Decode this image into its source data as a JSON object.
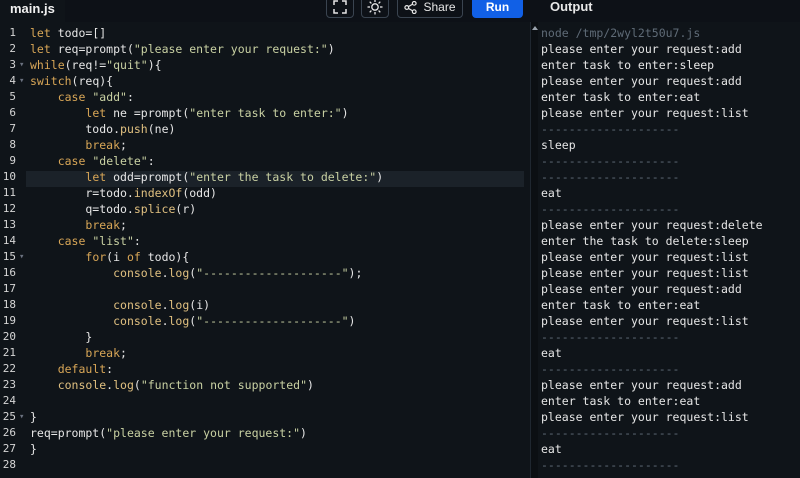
{
  "topbar": {
    "file_tab": "main.js",
    "share_label": "Share",
    "run_label": "Run",
    "output_title": "Output"
  },
  "editor": {
    "lines": [
      [
        {
          "c": "kw",
          "t": "let"
        },
        {
          "c": "pl",
          "t": " todo=[]"
        }
      ],
      [
        {
          "c": "kw",
          "t": "let"
        },
        {
          "c": "pl",
          "t": " req=prompt("
        },
        {
          "c": "str",
          "t": "\"please enter your request:\""
        },
        {
          "c": "pl",
          "t": ")"
        }
      ],
      [
        {
          "c": "kw",
          "t": "while"
        },
        {
          "c": "pl",
          "t": "(req!="
        },
        {
          "c": "str",
          "t": "\"quit\""
        },
        {
          "c": "pl",
          "t": "){"
        }
      ],
      [
        {
          "c": "kw",
          "t": "switch"
        },
        {
          "c": "pl",
          "t": "(req){"
        }
      ],
      [
        {
          "c": "pl",
          "t": "    "
        },
        {
          "c": "kw",
          "t": "case"
        },
        {
          "c": "pl",
          "t": " "
        },
        {
          "c": "str",
          "t": "\"add\""
        },
        {
          "c": "pl",
          "t": ":"
        }
      ],
      [
        {
          "c": "pl",
          "t": "        "
        },
        {
          "c": "kw",
          "t": "let"
        },
        {
          "c": "pl",
          "t": " ne =prompt("
        },
        {
          "c": "str",
          "t": "\"enter task to enter:\""
        },
        {
          "c": "pl",
          "t": ")"
        }
      ],
      [
        {
          "c": "pl",
          "t": "        todo."
        },
        {
          "c": "fnc",
          "t": "push"
        },
        {
          "c": "pl",
          "t": "(ne)"
        }
      ],
      [
        {
          "c": "pl",
          "t": "        "
        },
        {
          "c": "kw",
          "t": "break"
        },
        {
          "c": "pl",
          "t": ";"
        }
      ],
      [
        {
          "c": "pl",
          "t": "    "
        },
        {
          "c": "kw",
          "t": "case"
        },
        {
          "c": "pl",
          "t": " "
        },
        {
          "c": "str",
          "t": "\"delete\""
        },
        {
          "c": "pl",
          "t": ":"
        }
      ],
      [
        {
          "c": "pl",
          "t": "        "
        },
        {
          "c": "kw",
          "t": "let"
        },
        {
          "c": "pl",
          "t": " odd=prompt("
        },
        {
          "c": "str",
          "t": "\"enter the task to delete:\""
        },
        {
          "c": "pl",
          "t": ")"
        }
      ],
      [
        {
          "c": "pl",
          "t": "        r=todo."
        },
        {
          "c": "fnc",
          "t": "indexOf"
        },
        {
          "c": "pl",
          "t": "(odd)"
        }
      ],
      [
        {
          "c": "pl",
          "t": "        q=todo."
        },
        {
          "c": "fnc",
          "t": "splice"
        },
        {
          "c": "pl",
          "t": "(r)"
        }
      ],
      [
        {
          "c": "pl",
          "t": "        "
        },
        {
          "c": "kw",
          "t": "break"
        },
        {
          "c": "pl",
          "t": ";"
        }
      ],
      [
        {
          "c": "pl",
          "t": "    "
        },
        {
          "c": "kw",
          "t": "case"
        },
        {
          "c": "pl",
          "t": " "
        },
        {
          "c": "str",
          "t": "\"list\""
        },
        {
          "c": "pl",
          "t": ":"
        }
      ],
      [
        {
          "c": "pl",
          "t": "        "
        },
        {
          "c": "kw",
          "t": "for"
        },
        {
          "c": "pl",
          "t": "(i "
        },
        {
          "c": "kw",
          "t": "of"
        },
        {
          "c": "pl",
          "t": " todo){"
        }
      ],
      [
        {
          "c": "pl",
          "t": "            "
        },
        {
          "c": "fnc",
          "t": "console"
        },
        {
          "c": "pl",
          "t": "."
        },
        {
          "c": "fnc",
          "t": "log"
        },
        {
          "c": "pl",
          "t": "("
        },
        {
          "c": "str",
          "t": "\"--------------------\""
        },
        {
          "c": "pl",
          "t": ");"
        }
      ],
      [],
      [
        {
          "c": "pl",
          "t": "            "
        },
        {
          "c": "fnc",
          "t": "console"
        },
        {
          "c": "pl",
          "t": "."
        },
        {
          "c": "fnc",
          "t": "log"
        },
        {
          "c": "pl",
          "t": "(i)"
        }
      ],
      [
        {
          "c": "pl",
          "t": "            "
        },
        {
          "c": "fnc",
          "t": "console"
        },
        {
          "c": "pl",
          "t": "."
        },
        {
          "c": "fnc",
          "t": "log"
        },
        {
          "c": "pl",
          "t": "("
        },
        {
          "c": "str",
          "t": "\"--------------------\""
        },
        {
          "c": "pl",
          "t": ")"
        }
      ],
      [
        {
          "c": "pl",
          "t": "        }"
        }
      ],
      [
        {
          "c": "pl",
          "t": "        "
        },
        {
          "c": "kw",
          "t": "break"
        },
        {
          "c": "pl",
          "t": ";"
        }
      ],
      [
        {
          "c": "pl",
          "t": "    "
        },
        {
          "c": "kw",
          "t": "default"
        },
        {
          "c": "pl",
          "t": ":"
        }
      ],
      [
        {
          "c": "pl",
          "t": "    "
        },
        {
          "c": "fnc",
          "t": "console"
        },
        {
          "c": "pl",
          "t": "."
        },
        {
          "c": "fnc",
          "t": "log"
        },
        {
          "c": "pl",
          "t": "("
        },
        {
          "c": "str",
          "t": "\"function not supported\""
        },
        {
          "c": "pl",
          "t": ")"
        }
      ],
      [],
      [
        {
          "c": "pl",
          "t": "}"
        }
      ],
      [
        {
          "c": "pl",
          "t": "req=prompt("
        },
        {
          "c": "str",
          "t": "\"please enter your request:\""
        },
        {
          "c": "pl",
          "t": ")"
        }
      ],
      [
        {
          "c": "pl",
          "t": "}"
        }
      ],
      []
    ],
    "fold_lines": [
      3,
      4,
      15,
      25
    ]
  },
  "output": {
    "lines": [
      {
        "t": "node /tmp/2wyl2t50u7.js",
        "dim": true
      },
      {
        "t": "please enter your request:add"
      },
      {
        "t": "enter task to enter:sleep"
      },
      {
        "t": "please enter your request:add"
      },
      {
        "t": "enter task to enter:eat"
      },
      {
        "t": "please enter your request:list"
      },
      {
        "t": "--------------------",
        "dim": true
      },
      {
        "t": "sleep"
      },
      {
        "t": "--------------------",
        "dim": true
      },
      {
        "t": "--------------------",
        "dim": true
      },
      {
        "t": "eat"
      },
      {
        "t": "--------------------",
        "dim": true
      },
      {
        "t": "please enter your request:delete"
      },
      {
        "t": "enter the task to delete:sleep"
      },
      {
        "t": "please enter your request:list"
      },
      {
        "t": "please enter your request:list"
      },
      {
        "t": "please enter your request:add"
      },
      {
        "t": "enter task to enter:eat"
      },
      {
        "t": "please enter your request:list"
      },
      {
        "t": "--------------------",
        "dim": true
      },
      {
        "t": "eat"
      },
      {
        "t": "--------------------",
        "dim": true
      },
      {
        "t": "please enter your request:add"
      },
      {
        "t": "enter task to enter:eat"
      },
      {
        "t": "please enter your request:list"
      },
      {
        "t": "--------------------",
        "dim": true
      },
      {
        "t": "eat"
      },
      {
        "t": "--------------------",
        "dim": true
      }
    ]
  }
}
